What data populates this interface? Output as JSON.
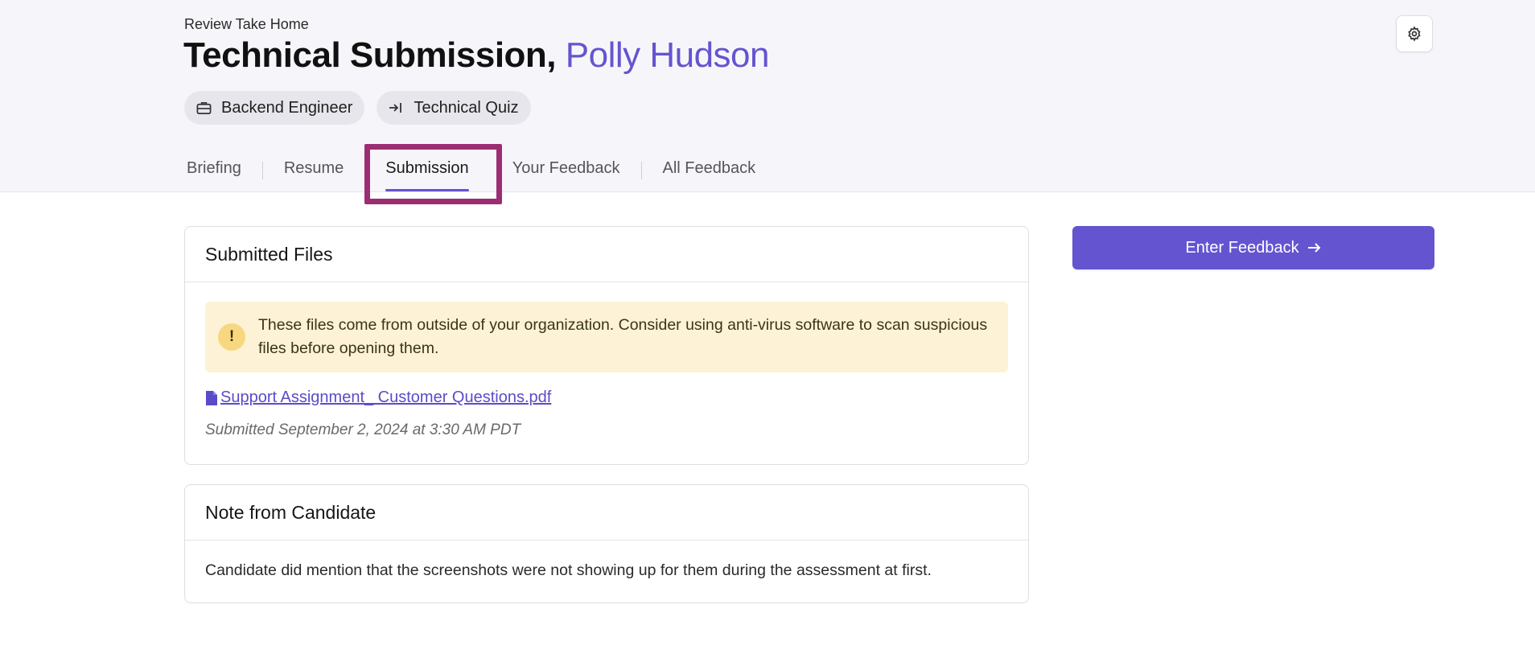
{
  "header": {
    "eyebrow": "Review Take Home",
    "title_prefix": "Technical Submission,",
    "candidate_name": "Polly Hudson",
    "chips": [
      {
        "label": "Backend Engineer",
        "icon": "briefcase-icon"
      },
      {
        "label": "Technical Quiz",
        "icon": "arrow-to-line-icon"
      }
    ],
    "settings_icon": "gear-icon"
  },
  "tabs": [
    {
      "label": "Briefing"
    },
    {
      "label": "Resume"
    },
    {
      "label": "Submission",
      "active": true
    },
    {
      "label": "Your Feedback"
    },
    {
      "label": "All Feedback"
    }
  ],
  "submitted_files": {
    "heading": "Submitted Files",
    "warning_icon": "!",
    "warning_text": "These files come from outside of your organization. Consider using anti-virus software to scan suspicious files before opening them.",
    "file_name": "Support Assignment_ Customer Questions.pdf",
    "submitted_at": "Submitted September 2, 2024 at 3:30 AM PDT"
  },
  "note": {
    "heading": "Note from Candidate",
    "text": "Candidate did mention that the screenshots were not showing up for them during the assessment at first."
  },
  "actions": {
    "enter_feedback": "Enter Feedback",
    "enter_feedback_icon": "arrow-right-icon"
  },
  "colors": {
    "accent": "#6454d0",
    "highlight_frame": "#9c2d73",
    "warning_bg": "#fdf2d6"
  }
}
